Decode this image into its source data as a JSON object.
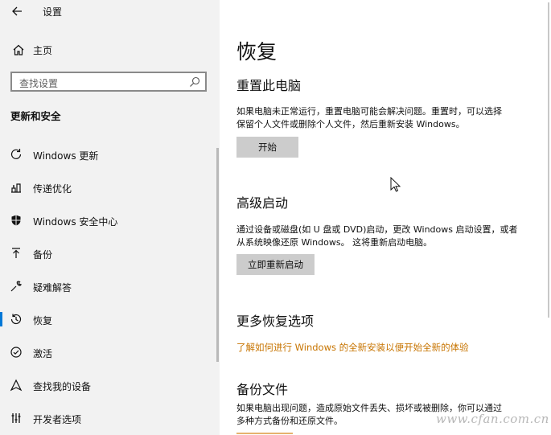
{
  "app": {
    "title": "设置"
  },
  "sidebar": {
    "home_label": "主页",
    "search_placeholder": "查找设置",
    "section_title": "更新和安全",
    "items": [
      {
        "label": "Windows 更新",
        "icon": "refresh-icon"
      },
      {
        "label": "传递优化",
        "icon": "delivery-icon"
      },
      {
        "label": "Windows 安全中心",
        "icon": "shield-icon"
      },
      {
        "label": "备份",
        "icon": "upload-icon"
      },
      {
        "label": "疑难解答",
        "icon": "wrench-icon"
      },
      {
        "label": "恢复",
        "icon": "history-icon",
        "selected": true
      },
      {
        "label": "激活",
        "icon": "check-circle-icon"
      },
      {
        "label": "查找我的设备",
        "icon": "find-device-icon"
      },
      {
        "label": "开发者选项",
        "icon": "developer-icon"
      }
    ]
  },
  "main": {
    "title": "恢复",
    "reset": {
      "heading": "重置此电脑",
      "line1": "如果电脑未正常运行，重置电脑可能会解决问题。重置时，可以选择",
      "line2": "保留个人文件或删除个人文件，然后重新安装 Windows。",
      "button": "开始"
    },
    "advanced": {
      "heading": "高级启动",
      "line1": "通过设备或磁盘(如 U 盘或 DVD)启动，更改 Windows 启动设置，或者",
      "line2": "从系统映像还原 Windows。 这将重新启动电脑。",
      "button": "立即重新启动"
    },
    "more": {
      "heading": "更多恢复选项",
      "link": "了解如何进行 Windows 的全新安装以便开始全新的体验"
    },
    "backup": {
      "heading": "备份文件",
      "line1": "如果电脑出现问题，造成原始文件丢失、损坏或被删除，你可以通过",
      "line2": "多种方式备份和还原文件。"
    }
  },
  "watermark": "www.cfan.com.cn"
}
